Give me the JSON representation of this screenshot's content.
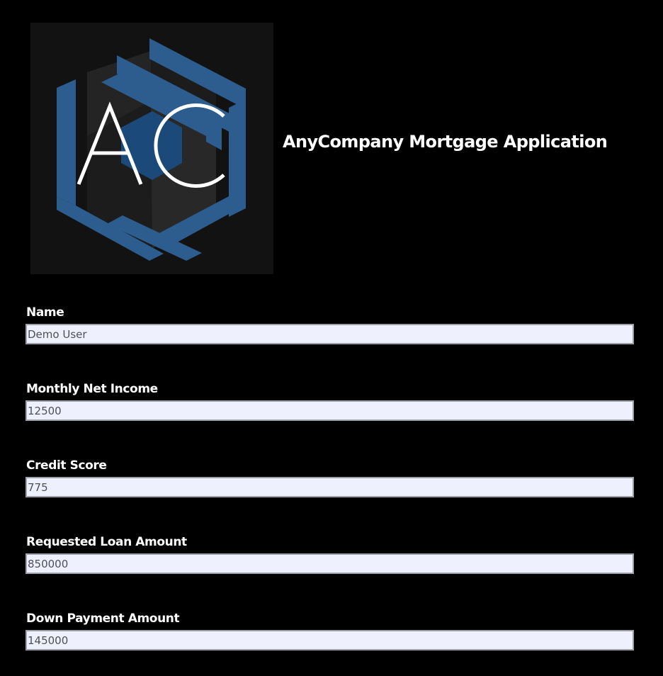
{
  "header": {
    "logo_icon": "anycompany-hexagon-logo-icon",
    "logo_text": "AC",
    "title": "AnyCompany Mortgage Application"
  },
  "form": {
    "fields": [
      {
        "label": "Name",
        "value": "Demo User"
      },
      {
        "label": "Monthly Net Income",
        "value": "12500"
      },
      {
        "label": "Credit Score",
        "value": "775"
      },
      {
        "label": "Requested Loan Amount",
        "value": "850000"
      },
      {
        "label": "Down Payment Amount",
        "value": "145000"
      }
    ]
  },
  "colors": {
    "background": "#000000",
    "logo_background": "#121212",
    "logo_accent": "#2d5c8e",
    "input_background": "#eef1fd",
    "input_border": "#9da0a8"
  }
}
